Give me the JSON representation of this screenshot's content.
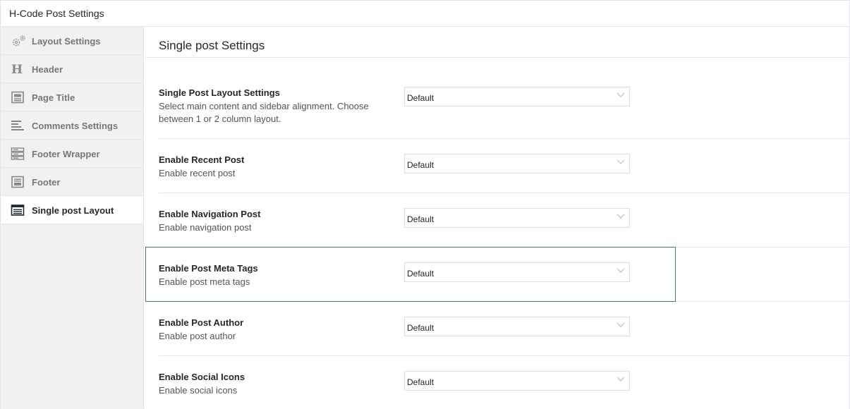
{
  "window": {
    "title": "H-Code Post Settings"
  },
  "sidebar": {
    "items": [
      {
        "label": "Layout Settings",
        "icon": "gears-icon"
      },
      {
        "label": "Header",
        "icon": "header-h-icon"
      },
      {
        "label": "Page Title",
        "icon": "page-title-icon"
      },
      {
        "label": "Comments Settings",
        "icon": "align-left-icon"
      },
      {
        "label": "Footer Wrapper",
        "icon": "server-stack-icon"
      },
      {
        "label": "Footer",
        "icon": "footer-panel-icon"
      },
      {
        "label": "Single post Layout",
        "icon": "list-window-icon",
        "active": true
      }
    ]
  },
  "main": {
    "heading": "Single post Settings",
    "rows": [
      {
        "label": "Single Post Layout Settings",
        "description": "Select main content and sidebar alignment. Choose between 1 or 2 column layout.",
        "value": "Default"
      },
      {
        "label": "Enable Recent Post",
        "description": "Enable recent post",
        "value": "Default"
      },
      {
        "label": "Enable Navigation Post",
        "description": "Enable navigation post",
        "value": "Default"
      },
      {
        "label": "Enable Post Meta Tags",
        "description": "Enable post meta tags",
        "value": "Default",
        "highlighted": true
      },
      {
        "label": "Enable Post Author",
        "description": "Enable post author",
        "value": "Default"
      },
      {
        "label": "Enable Social Icons",
        "description": "Enable social icons",
        "value": "Default"
      }
    ]
  },
  "colors": {
    "highlight_border": "#4b7a5b",
    "sidebar_bg": "#f1f1f1",
    "active_bg": "#ffffff"
  }
}
